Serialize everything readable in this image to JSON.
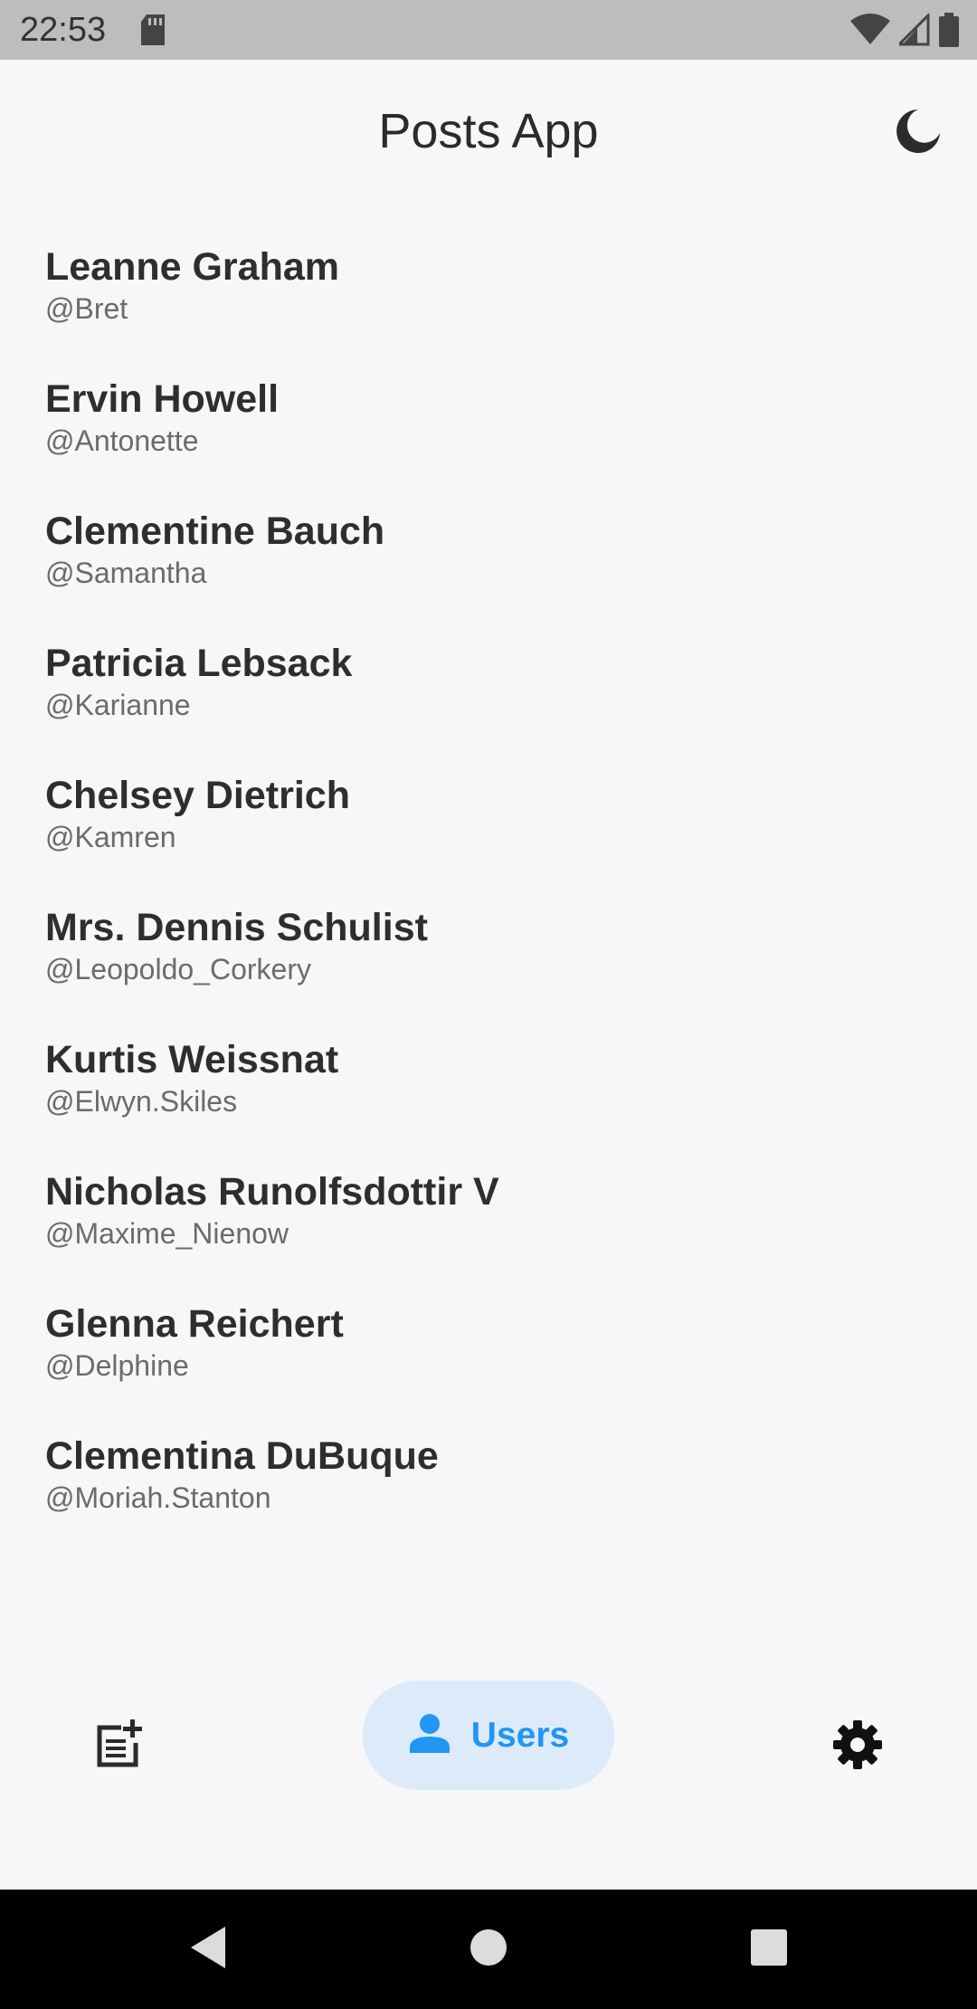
{
  "status_bar": {
    "time": "22:53",
    "icons": [
      "sd-card-icon",
      "wifi-icon",
      "cell-signal-icon",
      "battery-icon"
    ]
  },
  "app_bar": {
    "title": "Posts App",
    "theme_toggle_icon": "moon-icon"
  },
  "users": [
    {
      "name": "Leanne Graham",
      "handle": "@Bret"
    },
    {
      "name": "Ervin Howell",
      "handle": "@Antonette"
    },
    {
      "name": "Clementine Bauch",
      "handle": "@Samantha"
    },
    {
      "name": "Patricia Lebsack",
      "handle": "@Karianne"
    },
    {
      "name": "Chelsey Dietrich",
      "handle": "@Kamren"
    },
    {
      "name": "Mrs. Dennis Schulist",
      "handle": "@Leopoldo_Corkery"
    },
    {
      "name": "Kurtis Weissnat",
      "handle": "@Elwyn.Skiles"
    },
    {
      "name": "Nicholas Runolfsdottir V",
      "handle": "@Maxime_Nienow"
    },
    {
      "name": "Glenna Reichert",
      "handle": "@Delphine"
    },
    {
      "name": "Clementina DuBuque",
      "handle": "@Moriah.Stanton"
    }
  ],
  "bottom_nav": {
    "posts_icon": "post-add-icon",
    "users_label": "Users",
    "users_icon": "person-icon",
    "settings_icon": "gear-icon",
    "active": "users"
  },
  "colors": {
    "accent": "#2196f3",
    "active_pill": "#ddeafa",
    "background": "#f7f7f9",
    "status_bar": "#bdbdbd"
  }
}
